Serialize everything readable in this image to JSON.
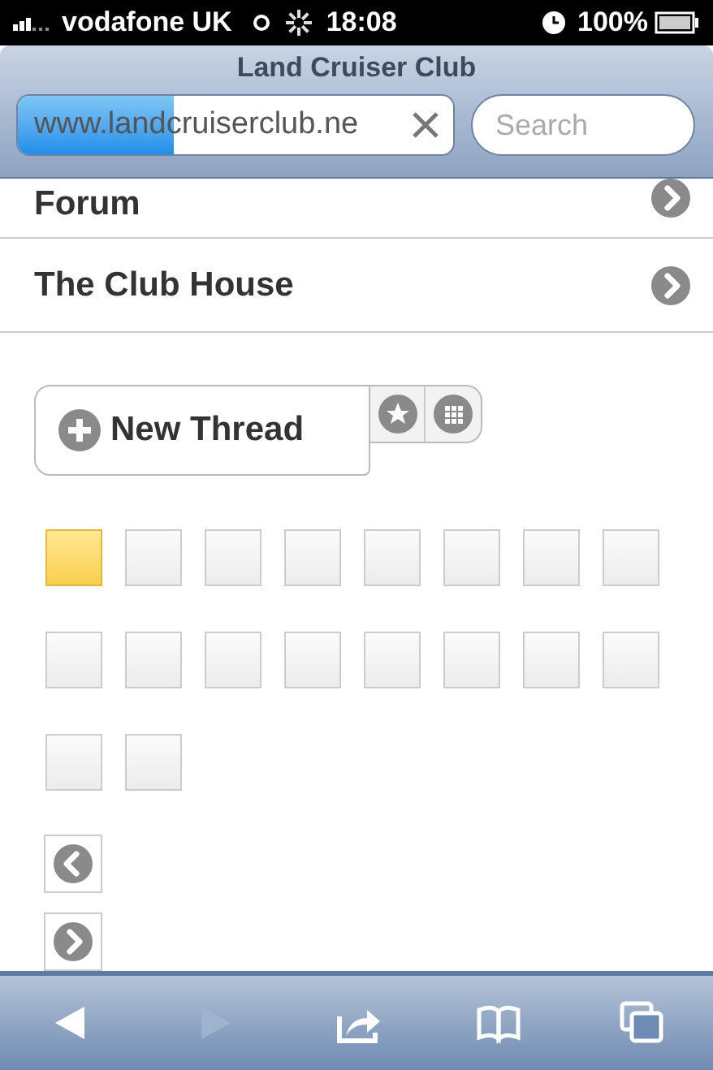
{
  "status_bar": {
    "carrier": "vodafone UK",
    "time": "18:08",
    "battery": "100%"
  },
  "title": "Land Cruiser Club",
  "address_bar": {
    "url": "www.landcruiserclub.ne",
    "level": 0.36
  },
  "search": {
    "placeholder": "Search"
  },
  "menu_items": [
    {
      "label": "Forum"
    },
    {
      "label": "The Club House"
    }
  ],
  "new_thread": {
    "label": "New Thread"
  },
  "tiles": [
    {
      "selected": true
    },
    {
      "selected": false
    },
    {
      "selected": false
    },
    {
      "selected": false
    },
    {
      "selected": false
    },
    {
      "selected": false
    },
    {
      "selected": false
    },
    {
      "selected": false
    },
    {
      "selected": false
    },
    {
      "selected": false
    },
    {
      "selected": false
    },
    {
      "selected": false
    },
    {
      "selected": false
    },
    {
      "selected": false
    },
    {
      "selected": false
    },
    {
      "selected": false
    },
    {
      "selected": false
    },
    {
      "selected": false
    }
  ],
  "pager": [
    {
      "kind": "previous"
    },
    {
      "kind": "next"
    }
  ],
  "toolbar": [
    {
      "kind": "back",
      "disabled": false
    },
    {
      "kind": "forward",
      "disabled": true
    },
    {
      "kind": "share",
      "disabled": false
    },
    {
      "kind": "bookmarks",
      "disabled": false
    },
    {
      "kind": "tabs",
      "disabled": false
    }
  ]
}
